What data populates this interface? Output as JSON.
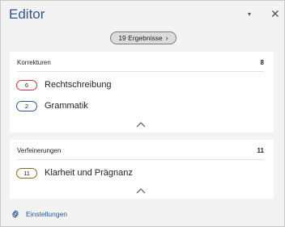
{
  "header": {
    "title": "Editor",
    "dropdown_icon": "▾",
    "close_icon": "✕"
  },
  "results_button": {
    "label": "19 Ergebnisse",
    "chevron": "›"
  },
  "corrections": {
    "heading": "Korrekturen",
    "count": "8",
    "items": [
      {
        "count": "6",
        "label": "Rechtschreibung",
        "color": "#d13438"
      },
      {
        "count": "2",
        "label": "Grammatik",
        "color": "#2b579a"
      }
    ]
  },
  "refinements": {
    "heading": "Verfeinerungen",
    "count": "11",
    "items": [
      {
        "count": "11",
        "label": "Klarheit und Prägnanz",
        "color": "#8a6a1f"
      }
    ]
  },
  "footer": {
    "settings_label": "Einstellungen",
    "settings_icon": "gear-icon"
  },
  "colors": {
    "accent": "#2b579a",
    "background": "#f3f3f3",
    "card": "#ffffff"
  }
}
